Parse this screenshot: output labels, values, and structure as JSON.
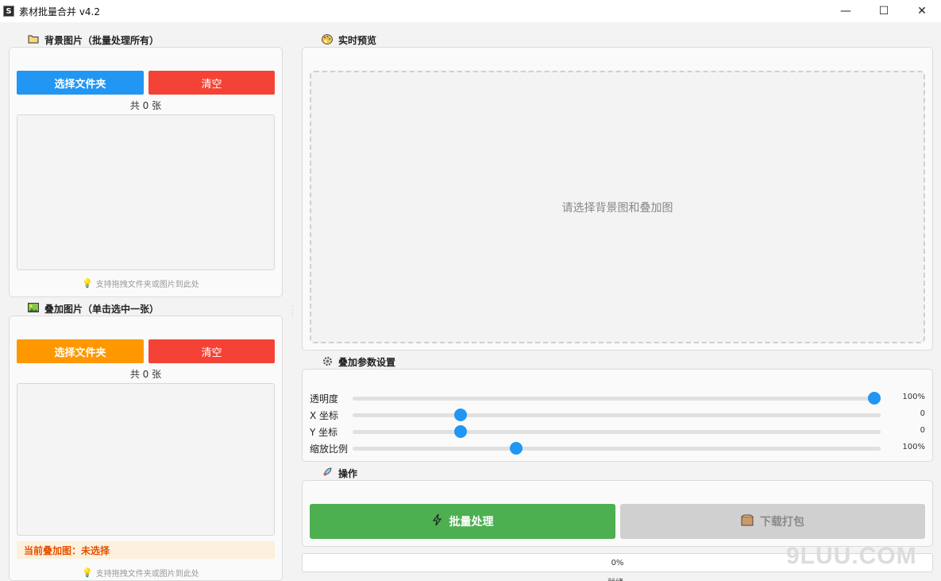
{
  "window": {
    "title": "素材批量合并 v4.2",
    "icon": "S",
    "minimize": "—",
    "maximize": "☐",
    "close": "✕"
  },
  "background_section": {
    "title": "背景图片（批量处理所有）",
    "icon": "folder-icon",
    "select_label": "选择文件夹",
    "clear_label": "清空",
    "count_text": "共 0 张",
    "hint": "支持拖拽文件夹或图片到此处"
  },
  "overlay_section": {
    "title": "叠加图片（单击选中一张）",
    "icon": "picture-icon",
    "select_label": "选择文件夹",
    "clear_label": "清空",
    "count_text": "共 0 张",
    "current_label": "当前叠加图：未选择",
    "hint": "支持拖拽文件夹或图片到此处"
  },
  "preview_section": {
    "title": "实时预览",
    "icon": "palette-icon",
    "placeholder": "请选择背景图和叠加图"
  },
  "settings_section": {
    "title": "叠加参数设置",
    "icon": "gear-icon",
    "sliders": [
      {
        "label": "透明度",
        "value_text": "100%",
        "fraction": 1.0
      },
      {
        "label": "X 坐标",
        "value_text": "0",
        "fraction": 0.207
      },
      {
        "label": "Y 坐标",
        "value_text": "0",
        "fraction": 0.207
      },
      {
        "label": "缩放比例",
        "value_text": "100%",
        "fraction": 0.314
      }
    ]
  },
  "actions_section": {
    "title": "操作",
    "icon": "rocket-icon",
    "batch_label": "批量处理",
    "batch_icon": "lightning-icon",
    "download_label": "下载打包",
    "download_icon": "package-icon"
  },
  "progress": {
    "text": "0%",
    "value": 0
  },
  "status": {
    "text": "就绪"
  },
  "watermark": "9LUU.COM",
  "colors": {
    "primary": "#2196f3",
    "danger": "#f44336",
    "warning": "#ff9800",
    "success": "#4caf50",
    "disabled": "#d0d0d0"
  }
}
